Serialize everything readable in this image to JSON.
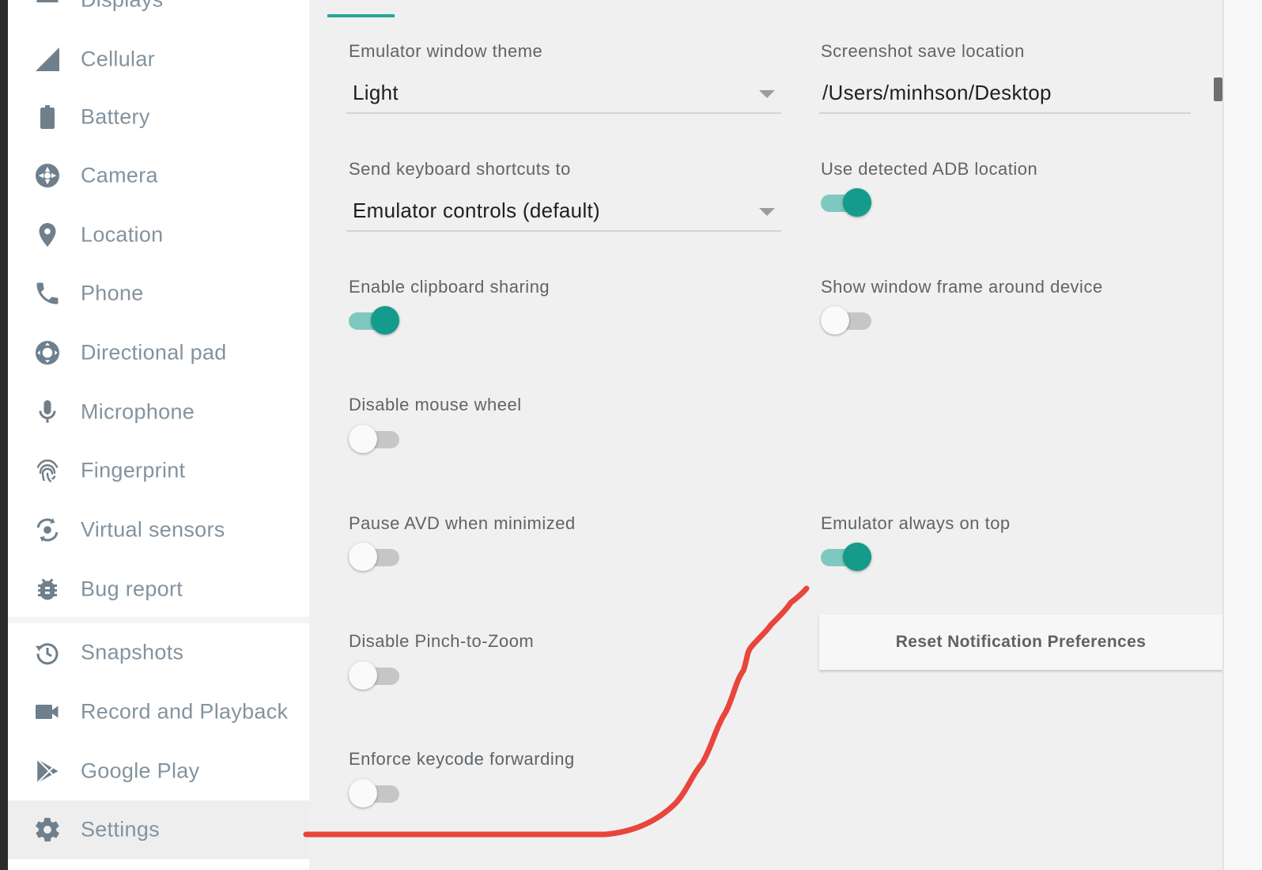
{
  "sidebar": {
    "items": [
      {
        "label": "Displays",
        "icon": "displays-icon"
      },
      {
        "label": "Cellular",
        "icon": "cellular-signal-icon"
      },
      {
        "label": "Battery",
        "icon": "battery-icon"
      },
      {
        "label": "Camera",
        "icon": "camera-shutter-icon"
      },
      {
        "label": "Location",
        "icon": "location-pin-icon"
      },
      {
        "label": "Phone",
        "icon": "phone-icon"
      },
      {
        "label": "Directional pad",
        "icon": "dpad-icon"
      },
      {
        "label": "Microphone",
        "icon": "microphone-icon"
      },
      {
        "label": "Fingerprint",
        "icon": "fingerprint-icon"
      },
      {
        "label": "Virtual sensors",
        "icon": "rotate-sensor-icon"
      },
      {
        "label": "Bug report",
        "icon": "bug-icon"
      },
      {
        "label": "Snapshots",
        "icon": "history-icon"
      },
      {
        "label": "Record and Playback",
        "icon": "video-camera-icon"
      },
      {
        "label": "Google Play",
        "icon": "play-store-icon"
      },
      {
        "label": "Settings",
        "icon": "gear-icon"
      }
    ],
    "active_item": "Settings"
  },
  "settings": {
    "theme": {
      "label": "Emulator window theme",
      "value": "Light"
    },
    "screenshot": {
      "label": "Screenshot save location",
      "value": "/Users/minhson/Desktop"
    },
    "shortcuts": {
      "label": "Send keyboard shortcuts to",
      "value": "Emulator controls (default)"
    },
    "adb": {
      "label": "Use detected ADB location",
      "on": true
    },
    "clipboard": {
      "label": "Enable clipboard sharing",
      "on": true
    },
    "frame": {
      "label": "Show window frame around device",
      "on": false
    },
    "mouse_wheel": {
      "label": "Disable mouse wheel",
      "on": false
    },
    "pause_avd": {
      "label": "Pause AVD when minimized",
      "on": false
    },
    "always_on_top": {
      "label": "Emulator always on top",
      "on": true
    },
    "pinch_zoom": {
      "label": "Disable Pinch-to-Zoom",
      "on": false
    },
    "keycode": {
      "label": "Enforce keycode forwarding",
      "on": false
    },
    "reset_button": "Reset Notification Preferences"
  },
  "colors": {
    "accent": "#149b8b",
    "annotation_stroke": "#e8453c",
    "sidebar_text": "#83939e"
  }
}
